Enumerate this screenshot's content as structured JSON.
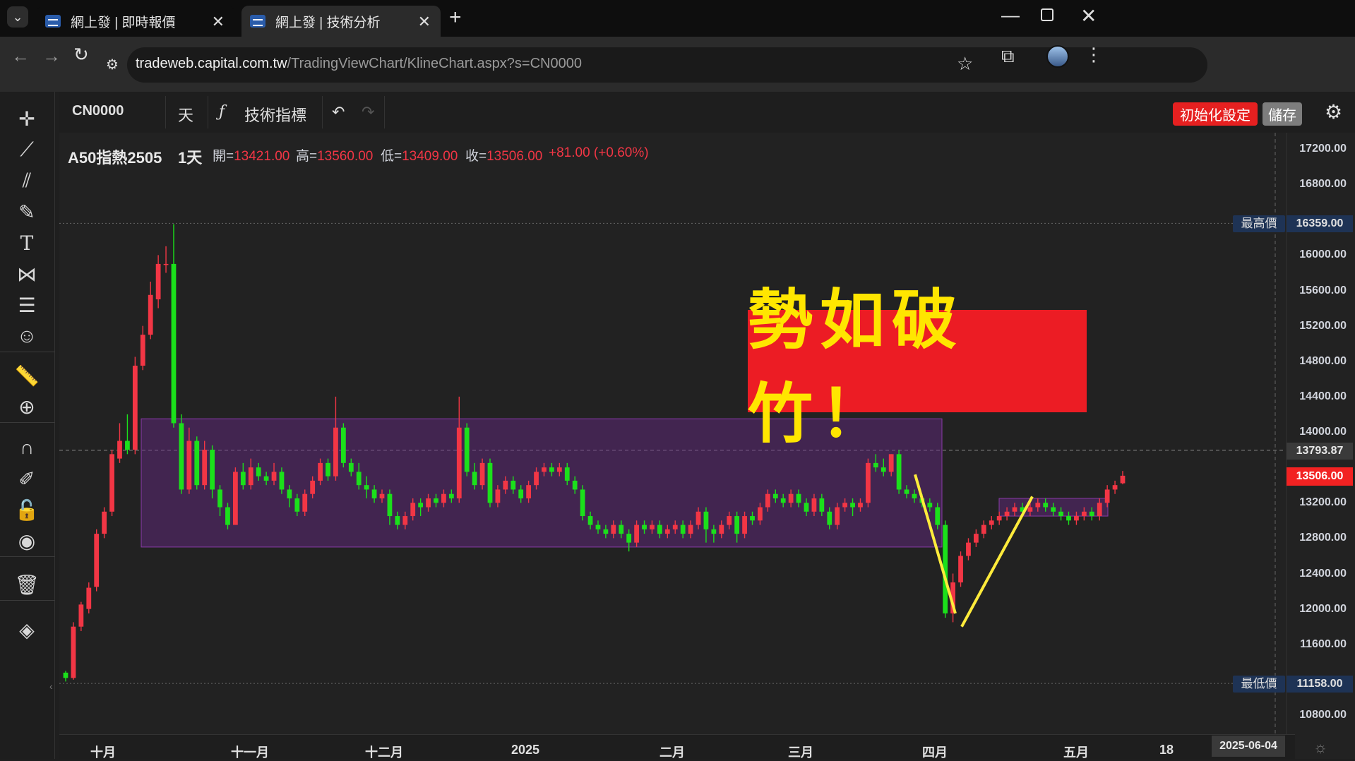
{
  "browser": {
    "tabs": [
      {
        "title": "網上發 | 即時報價",
        "active": false
      },
      {
        "title": "網上發 | 技術分析",
        "active": true
      }
    ],
    "url_host": "tradeweb.capital.com.tw",
    "url_path": "/TradingViewChart/KlineChart.aspx?s=CN0000",
    "new_tab": "+",
    "window_controls": [
      "minimize-icon",
      "restore-icon",
      "close-icon"
    ]
  },
  "toolbar": {
    "symbol": "CN0000",
    "interval": "天",
    "indicators_label": "技術指標",
    "reset_label": "初始化設定",
    "save_label": "儲存"
  },
  "legend": {
    "name": "A50指熱2505",
    "interval": "1天",
    "open_label": "開=",
    "open": "13421.00",
    "high_label": "高=",
    "high": "13560.00",
    "low_label": "低=",
    "low": "13409.00",
    "close_label": "收=",
    "close": "13506.00",
    "change": "+81.00 (+0.60%)"
  },
  "banner_text": "勢如破竹！",
  "price_axis": {
    "ticks": [
      "17200.00",
      "16800.00",
      "16000.00",
      "15600.00",
      "15200.00",
      "14800.00",
      "14400.00",
      "14000.00",
      "13200.00",
      "12800.00",
      "12400.00",
      "12000.00",
      "11600.00",
      "10800.00"
    ],
    "high_label": "最高價",
    "high_value": "16359.00",
    "low_label": "最低價",
    "low_value": "11158.00",
    "crosshair_value": "13793.87",
    "last_value": "13506.00"
  },
  "time_axis": {
    "labels": [
      "十月",
      "十一月",
      "十二月",
      "2025",
      "二月",
      "三月",
      "四月",
      "五月",
      "18"
    ],
    "crosshair_date": "2025-06-04"
  },
  "colors": {
    "up": "#f23645",
    "down": "#1be01b",
    "range_box": "#6b2a8a",
    "trend_line": "#ffeb3b",
    "banner_bg": "#ec1c24",
    "banner_text": "#ffe600"
  },
  "chart_data": {
    "type": "candlestick",
    "title": "A50指熱2505",
    "ylim": [
      10600,
      17400
    ],
    "series": [
      {
        "name": "A50指熱2505",
        "values": [
          [
            11280,
            11220,
            11300,
            11180
          ],
          [
            11220,
            11800,
            11850,
            11200
          ],
          [
            11800,
            12050,
            12080,
            11750
          ],
          [
            12000,
            12240,
            12300,
            11950
          ],
          [
            12250,
            12850,
            12900,
            12200
          ],
          [
            12850,
            13100,
            13150,
            12800
          ],
          [
            13100,
            13750,
            13800,
            13050
          ],
          [
            13700,
            13900,
            14100,
            13650
          ],
          [
            13900,
            13800,
            14200,
            13750
          ],
          [
            13800,
            14750,
            14850,
            13750
          ],
          [
            14750,
            15100,
            15200,
            14700
          ],
          [
            15100,
            15550,
            15700,
            15050
          ],
          [
            15500,
            15900,
            16000,
            15400
          ],
          [
            15900,
            15900,
            16100,
            15800
          ],
          [
            15900,
            14100,
            16350,
            14050
          ],
          [
            14100,
            13350,
            14200,
            13300
          ],
          [
            13350,
            13900,
            14050,
            13300
          ],
          [
            13900,
            13400,
            13950,
            13350
          ],
          [
            13400,
            13800,
            13900,
            13350
          ],
          [
            13800,
            13350,
            13850,
            13250
          ],
          [
            13350,
            13150,
            13400,
            13050
          ],
          [
            13150,
            12950,
            13200,
            12900
          ],
          [
            12950,
            13550,
            13600,
            12950
          ],
          [
            13550,
            13400,
            13650,
            13350
          ],
          [
            13400,
            13600,
            13700,
            13350
          ],
          [
            13600,
            13500,
            13650,
            13450
          ],
          [
            13500,
            13450,
            13550,
            13400
          ],
          [
            13450,
            13550,
            13650,
            13400
          ],
          [
            13550,
            13350,
            13600,
            13300
          ],
          [
            13350,
            13250,
            13400,
            13150
          ],
          [
            13250,
            13100,
            13300,
            13050
          ],
          [
            13100,
            13300,
            13350,
            13050
          ],
          [
            13300,
            13450,
            13500,
            13250
          ],
          [
            13450,
            13650,
            13700,
            13400
          ],
          [
            13650,
            13500,
            13700,
            13450
          ],
          [
            13500,
            14050,
            14400,
            13450
          ],
          [
            14050,
            13650,
            14100,
            13600
          ],
          [
            13650,
            13550,
            13700,
            13500
          ],
          [
            13550,
            13400,
            13650,
            13350
          ],
          [
            13400,
            13350,
            13500,
            13250
          ],
          [
            13350,
            13250,
            13400,
            13200
          ],
          [
            13250,
            13300,
            13350,
            13200
          ],
          [
            13300,
            13050,
            13350,
            12950
          ],
          [
            13050,
            12950,
            13100,
            12900
          ],
          [
            12950,
            13050,
            13100,
            12900
          ],
          [
            13050,
            13200,
            13250,
            13000
          ],
          [
            13200,
            13150,
            13250,
            13050
          ],
          [
            13150,
            13250,
            13300,
            13100
          ],
          [
            13250,
            13200,
            13300,
            13150
          ],
          [
            13200,
            13300,
            13350,
            13150
          ],
          [
            13300,
            13250,
            13350,
            13200
          ],
          [
            13250,
            14050,
            14400,
            13200
          ],
          [
            14050,
            13550,
            14100,
            13500
          ],
          [
            13550,
            13400,
            13650,
            13350
          ],
          [
            13400,
            13650,
            13700,
            13350
          ],
          [
            13650,
            13200,
            13700,
            13150
          ],
          [
            13200,
            13350,
            13400,
            13150
          ],
          [
            13350,
            13450,
            13500,
            13300
          ],
          [
            13450,
            13350,
            13500,
            13300
          ],
          [
            13350,
            13250,
            13400,
            13200
          ],
          [
            13250,
            13400,
            13450,
            13200
          ],
          [
            13400,
            13550,
            13600,
            13350
          ],
          [
            13550,
            13600,
            13650,
            13500
          ],
          [
            13600,
            13550,
            13650,
            13500
          ],
          [
            13550,
            13600,
            13650,
            13500
          ],
          [
            13600,
            13450,
            13650,
            13400
          ],
          [
            13450,
            13350,
            13500,
            13300
          ],
          [
            13350,
            13050,
            13400,
            13000
          ],
          [
            13050,
            12950,
            13100,
            12900
          ],
          [
            12950,
            12900,
            13000,
            12850
          ],
          [
            12900,
            12850,
            12950,
            12800
          ],
          [
            12850,
            12950,
            13000,
            12800
          ],
          [
            12950,
            12850,
            13000,
            12800
          ],
          [
            12850,
            12750,
            12900,
            12650
          ],
          [
            12750,
            12950,
            13000,
            12700
          ],
          [
            12950,
            12900,
            13000,
            12850
          ],
          [
            12900,
            12950,
            13000,
            12850
          ],
          [
            12950,
            12850,
            13000,
            12800
          ],
          [
            12850,
            12900,
            12950,
            12800
          ],
          [
            12900,
            12950,
            13000,
            12850
          ],
          [
            12950,
            12850,
            13000,
            12800
          ],
          [
            12850,
            12950,
            13000,
            12800
          ],
          [
            12950,
            13100,
            13150,
            12900
          ],
          [
            13100,
            12900,
            13150,
            12750
          ],
          [
            12900,
            12850,
            12950,
            12750
          ],
          [
            12850,
            12950,
            13000,
            12800
          ],
          [
            12950,
            13050,
            13100,
            12900
          ],
          [
            13050,
            12850,
            13100,
            12750
          ],
          [
            12850,
            13050,
            13100,
            12800
          ],
          [
            13050,
            13000,
            13100,
            12950
          ],
          [
            13000,
            13150,
            13200,
            12950
          ],
          [
            13150,
            13300,
            13350,
            13100
          ],
          [
            13300,
            13250,
            13350,
            13200
          ],
          [
            13250,
            13200,
            13300,
            13150
          ],
          [
            13200,
            13300,
            13350,
            13150
          ],
          [
            13300,
            13200,
            13350,
            13150
          ],
          [
            13200,
            13100,
            13250,
            13050
          ],
          [
            13100,
            13250,
            13300,
            13050
          ],
          [
            13250,
            13100,
            13300,
            13050
          ],
          [
            13100,
            12950,
            13150,
            12900
          ],
          [
            12950,
            13150,
            13200,
            12900
          ],
          [
            13150,
            13200,
            13250,
            13100
          ],
          [
            13200,
            13150,
            13250,
            13050
          ],
          [
            13150,
            13200,
            13250,
            13100
          ],
          [
            13200,
            13650,
            13700,
            13150
          ],
          [
            13650,
            13600,
            13750,
            13550
          ],
          [
            13600,
            13550,
            13700,
            13500
          ],
          [
            13550,
            13750,
            13750,
            13500
          ],
          [
            13750,
            13350,
            13800,
            13300
          ],
          [
            13350,
            13300,
            13400,
            13250
          ],
          [
            13300,
            13250,
            13350,
            13200
          ],
          [
            13250,
            13200,
            13300,
            13150
          ],
          [
            13200,
            13150,
            13250,
            13100
          ],
          [
            13150,
            12950,
            13200,
            12900
          ],
          [
            12950,
            11950,
            13000,
            11900
          ],
          [
            11950,
            12300,
            12400,
            11850
          ],
          [
            12300,
            12600,
            12650,
            12250
          ],
          [
            12600,
            12750,
            12800,
            12550
          ],
          [
            12750,
            12850,
            12900,
            12700
          ],
          [
            12850,
            12950,
            13000,
            12800
          ],
          [
            12950,
            13000,
            13050,
            12900
          ],
          [
            13000,
            13050,
            13100,
            12950
          ],
          [
            13050,
            13100,
            13150,
            13000
          ],
          [
            13100,
            13150,
            13200,
            13050
          ],
          [
            13150,
            13100,
            13200,
            13050
          ],
          [
            13100,
            13150,
            13200,
            13050
          ],
          [
            13150,
            13200,
            13250,
            13100
          ],
          [
            13200,
            13150,
            13250,
            13100
          ],
          [
            13150,
            13100,
            13200,
            13050
          ],
          [
            13100,
            13050,
            13150,
            13000
          ],
          [
            13050,
            13000,
            13100,
            12950
          ],
          [
            13000,
            13050,
            13100,
            12950
          ],
          [
            13050,
            13100,
            13150,
            13000
          ],
          [
            13100,
            13050,
            13150,
            13000
          ],
          [
            13050,
            13200,
            13250,
            13000
          ],
          [
            13200,
            13350,
            13400,
            13150
          ],
          [
            13350,
            13400,
            13450,
            13300
          ],
          [
            13421,
            13506,
            13560,
            13409
          ]
        ]
      }
    ],
    "annotations": {
      "range_box_1": {
        "price_top": 14150,
        "price_bottom": 12700
      },
      "range_box_2": {
        "price_top": 13250,
        "price_bottom": 13050
      },
      "high": 16359.0,
      "low": 11158.0,
      "crosshair_price": 13793.87
    }
  }
}
